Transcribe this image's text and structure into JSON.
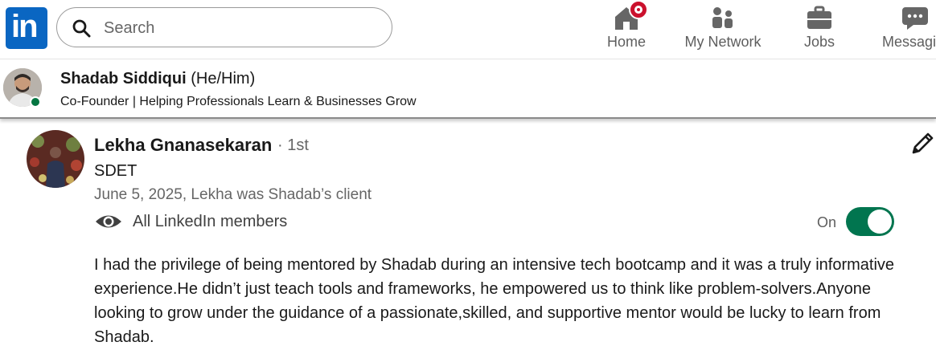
{
  "nav": {
    "logo": "in",
    "search_placeholder": "Search",
    "items": [
      {
        "label": "Home",
        "icon": "home-icon"
      },
      {
        "label": "My Network",
        "icon": "network-icon"
      },
      {
        "label": "Jobs",
        "icon": "briefcase-icon"
      },
      {
        "label": "Messaging",
        "icon": "messaging-icon"
      }
    ]
  },
  "profile": {
    "name": "Shadab Siddiqui",
    "pronouns": "(He/Him)",
    "headline": "Co-Founder | Helping Professionals Learn & Businesses Grow"
  },
  "recommendation": {
    "name": "Lekha Gnanasekaran",
    "degree": "· 1st",
    "title": "SDET",
    "date_relation": "June 5, 2025, Lekha was Shadab’s client",
    "visibility": "All LinkedIn members",
    "toggle_label": "On",
    "toggle_on": true,
    "text": "I had the privilege of being mentored by Shadab during an intensive tech bootcamp and it was a truly informative experience.He didn’t just teach tools and frameworks, he empowered us to think like problem-solvers.Anyone looking to grow under the guidance of a passionate,skilled, and supportive mentor would be lucky to learn from Shadab."
  },
  "colors": {
    "brand": "#0a66c2",
    "toggle": "#01754f",
    "badge": "#cb112d",
    "online": "#057642"
  }
}
